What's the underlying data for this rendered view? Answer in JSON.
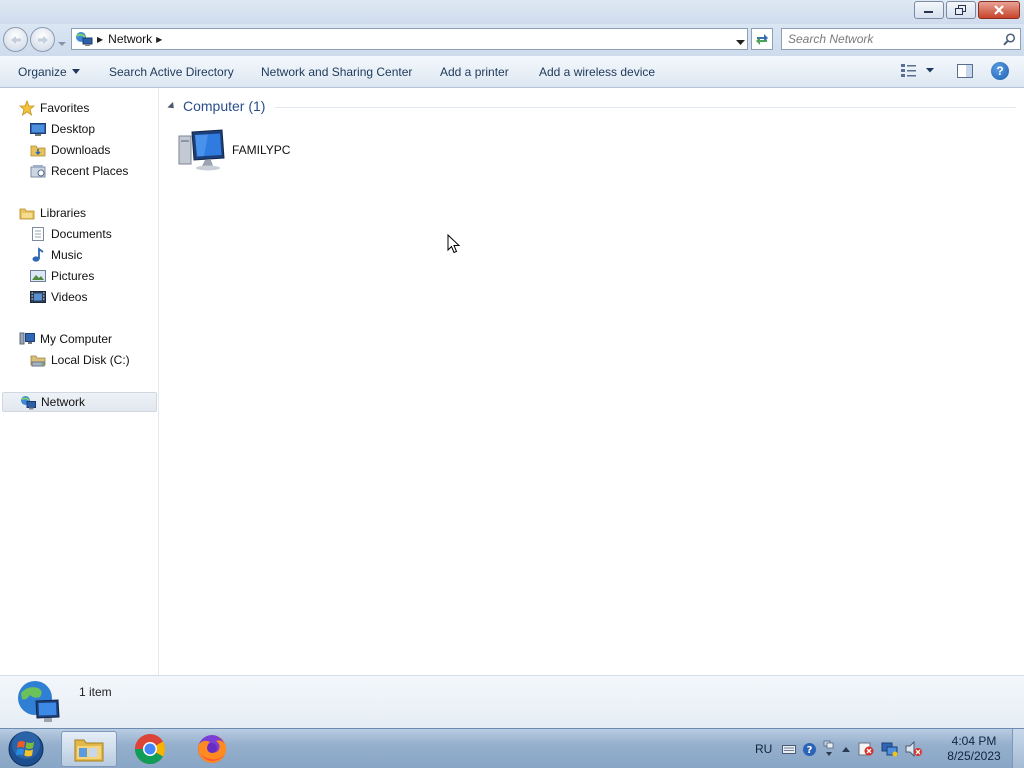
{
  "window": {
    "title": "Network",
    "controls": {
      "minimize": "minimize",
      "maximize": "restore",
      "close": "close"
    }
  },
  "address_bar": {
    "breadcrumb": [
      "Network"
    ],
    "search_placeholder": "Search Network"
  },
  "command_bar": {
    "organize": "Organize",
    "commands": [
      "Search Active Directory",
      "Network and Sharing Center",
      "Add a printer",
      "Add a wireless device"
    ]
  },
  "nav_pane": {
    "favorites": {
      "label": "Favorites",
      "items": [
        "Desktop",
        "Downloads",
        "Recent Places"
      ]
    },
    "libraries": {
      "label": "Libraries",
      "items": [
        "Documents",
        "Music",
        "Pictures",
        "Videos"
      ]
    },
    "computer": {
      "label": "My Computer",
      "items": [
        "Local Disk (C:)"
      ]
    },
    "network": {
      "label": "Network",
      "selected": true
    }
  },
  "content": {
    "group_title": "Computer (1)",
    "items": [
      {
        "name": "FAMILYPC",
        "icon": "computer-icon"
      }
    ]
  },
  "details_pane": {
    "item_count": "1 item"
  },
  "taskbar": {
    "apps": [
      "explorer",
      "chrome",
      "firefox"
    ],
    "tray": {
      "language": "RU"
    },
    "clock": {
      "time": "4:04 PM",
      "date": "8/25/2023"
    }
  },
  "colors": {
    "accent": "#2a4f8c",
    "command_text": "#1e395b",
    "taskbar": "#95afcc",
    "selection": "#e2e8f0"
  }
}
